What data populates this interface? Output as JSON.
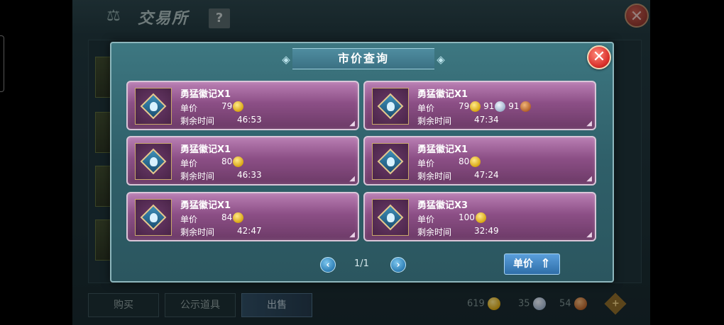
{
  "background": {
    "title": "交易所",
    "help_label": "?",
    "close_label": "✕",
    "tabs": [
      {
        "label": "购买",
        "active": false
      },
      {
        "label": "公示道具",
        "active": false
      },
      {
        "label": "出售",
        "active": true
      }
    ],
    "currencies": [
      {
        "value": "619",
        "type": "gold"
      },
      {
        "value": "35",
        "type": "silver"
      },
      {
        "value": "54",
        "type": "bronze"
      }
    ],
    "add_label": "+"
  },
  "modal": {
    "title": "市价查询",
    "close_label": "✕",
    "price_label": "单价",
    "time_label": "剩余时间",
    "listings": [
      {
        "name": "勇猛徽记X1",
        "prices": [
          {
            "value": "79",
            "currency": "gold"
          }
        ],
        "time": "46:53"
      },
      {
        "name": "勇猛徽记X1",
        "prices": [
          {
            "value": "79",
            "currency": "gold"
          },
          {
            "value": "91",
            "currency": "silver"
          },
          {
            "value": "91",
            "currency": "bronze"
          }
        ],
        "time": "47:34"
      },
      {
        "name": "勇猛徽记X1",
        "prices": [
          {
            "value": "80",
            "currency": "gold"
          }
        ],
        "time": "46:33"
      },
      {
        "name": "勇猛徽记X1",
        "prices": [
          {
            "value": "80",
            "currency": "gold"
          }
        ],
        "time": "47:24"
      },
      {
        "name": "勇猛徽记X1",
        "prices": [
          {
            "value": "84",
            "currency": "gold"
          }
        ],
        "time": "42:47"
      },
      {
        "name": "勇猛徽记X3",
        "prices": [
          {
            "value": "100",
            "currency": "gold"
          }
        ],
        "time": "32:49"
      }
    ],
    "pager": {
      "prev_label": "‹",
      "next_label": "›",
      "page_text": "1/1"
    },
    "sort_button_label": "单价",
    "sort_icon": "up-arrow-icon"
  },
  "colors": {
    "card_top": "#b97eb3",
    "card_bottom": "#6c3a67",
    "modal_bg": "#3d7781",
    "close_red": "#d9302b",
    "button_blue": "#2f6ea8"
  }
}
